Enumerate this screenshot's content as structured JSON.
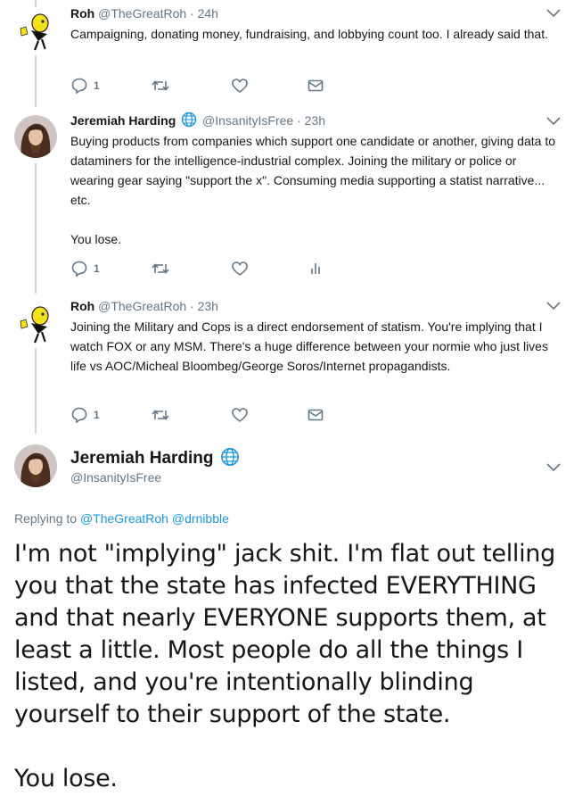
{
  "tweets": [
    {
      "name": "Roh",
      "handle": "@TheGreatRoh",
      "time": "24h",
      "text": [
        "Campaigning, donating money, fundraising, and lobbying count too. I already said that."
      ],
      "reply_count": "1",
      "extra_icon": "mail-icon"
    },
    {
      "name": "Jeremiah Harding",
      "handle": "@InsanityIsFree",
      "time": "23h",
      "verified_icon": "globe-icon",
      "text": [
        "Buying products from companies which support one candidate or another, giving data to dataminers for the intelligence-industrial complex. Joining the military or police or wearing gear saying \"support the x\". Consuming media supporting a statist narrative... etc.",
        "You lose."
      ],
      "reply_count": "1",
      "extra_icon": "analytics-icon"
    },
    {
      "name": "Roh",
      "handle": "@TheGreatRoh",
      "time": "23h",
      "text": [
        "Joining the Military and Cops is a direct endorsement of statism. You're implying that I watch FOX or any MSM. There's a huge difference between your normie who just lives life vs AOC/Micheal Bloombeg/George Soros/Internet propagandists."
      ],
      "reply_count": "1",
      "extra_icon": "mail-icon"
    }
  ],
  "main_tweet": {
    "name": "Jeremiah Harding",
    "handle": "@InsanityIsFree",
    "verified_icon": "globe-icon",
    "replying_prefix": "Replying to",
    "mentions": [
      "@TheGreatRoh",
      "@drnibble"
    ],
    "text": [
      "I'm not \"implying\" jack shit. I'm flat out telling you that the state has infected EVERYTHING and that nearly EVERYONE supports them, at least a little. Most people do all the things I listed, and you're intentionally blinding yourself to their support of the state.",
      "You lose."
    ]
  },
  "colors": {
    "text": "#14171a",
    "secondary": "#657786",
    "link": "#1b95e0",
    "thread_line": "#ccd6dd"
  }
}
